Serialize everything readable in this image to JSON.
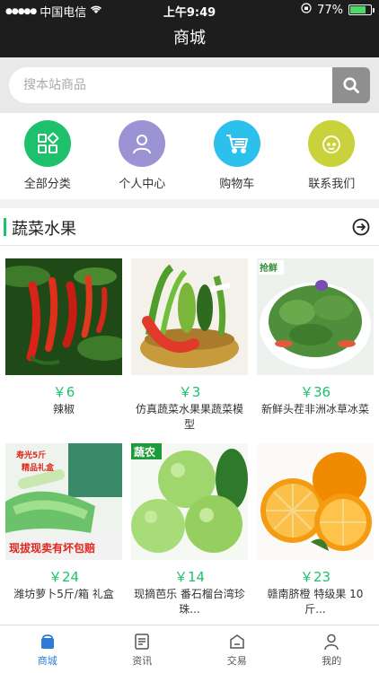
{
  "status": {
    "carrier": "中国电信",
    "time": "上午9:49",
    "battery": "77%",
    "battery_level": 0.77
  },
  "nav": {
    "title": "商城"
  },
  "search": {
    "placeholder": "搜本站商品"
  },
  "quick": [
    {
      "label": "全部分类",
      "color": "#1ec16b",
      "icon": "grid-icon"
    },
    {
      "label": "个人中心",
      "color": "#9b93d4",
      "icon": "person-icon"
    },
    {
      "label": "购物车",
      "color": "#2cc1ec",
      "icon": "cart-icon"
    },
    {
      "label": "联系我们",
      "color": "#c9d23a",
      "icon": "face-icon"
    }
  ],
  "section": {
    "title": "蔬菜水果"
  },
  "products": [
    {
      "price": "￥6",
      "name": "辣椒",
      "icon": "chili-pepper-photo"
    },
    {
      "price": "￥3",
      "name": "仿真蔬菜水果果蔬菜模型",
      "icon": "vegetable-basket-photo"
    },
    {
      "price": "￥36",
      "name": "新鲜头茬非洲冰草冰菜",
      "badge": "抢鲜",
      "icon": "ice-plant-photo"
    },
    {
      "price": "￥24",
      "name": "潍坊萝卜5斤/箱 礼盒",
      "badge_top": "寿光5斤",
      "badge_gift": "精品礼盒",
      "badge_bottom": "现拔现卖有坏包赔",
      "icon": "radish-photo"
    },
    {
      "price": "￥14",
      "name": "现摘芭乐 番石榴台湾珍珠...",
      "badge": "蔬农",
      "icon": "guava-photo"
    },
    {
      "price": "￥23",
      "name": "赣南脐橙 特级果 10斤...",
      "icon": "orange-photo"
    }
  ],
  "tabs": [
    {
      "label": "商城",
      "icon": "shop-icon",
      "active": true
    },
    {
      "label": "资讯",
      "icon": "news-icon",
      "active": false
    },
    {
      "label": "交易",
      "icon": "trade-icon",
      "active": false
    },
    {
      "label": "我的",
      "icon": "user-icon",
      "active": false
    }
  ],
  "colors": {
    "accent": "#1ec16b",
    "tab_active": "#2e7bd6",
    "bar_bg": "#1d1d1d"
  }
}
